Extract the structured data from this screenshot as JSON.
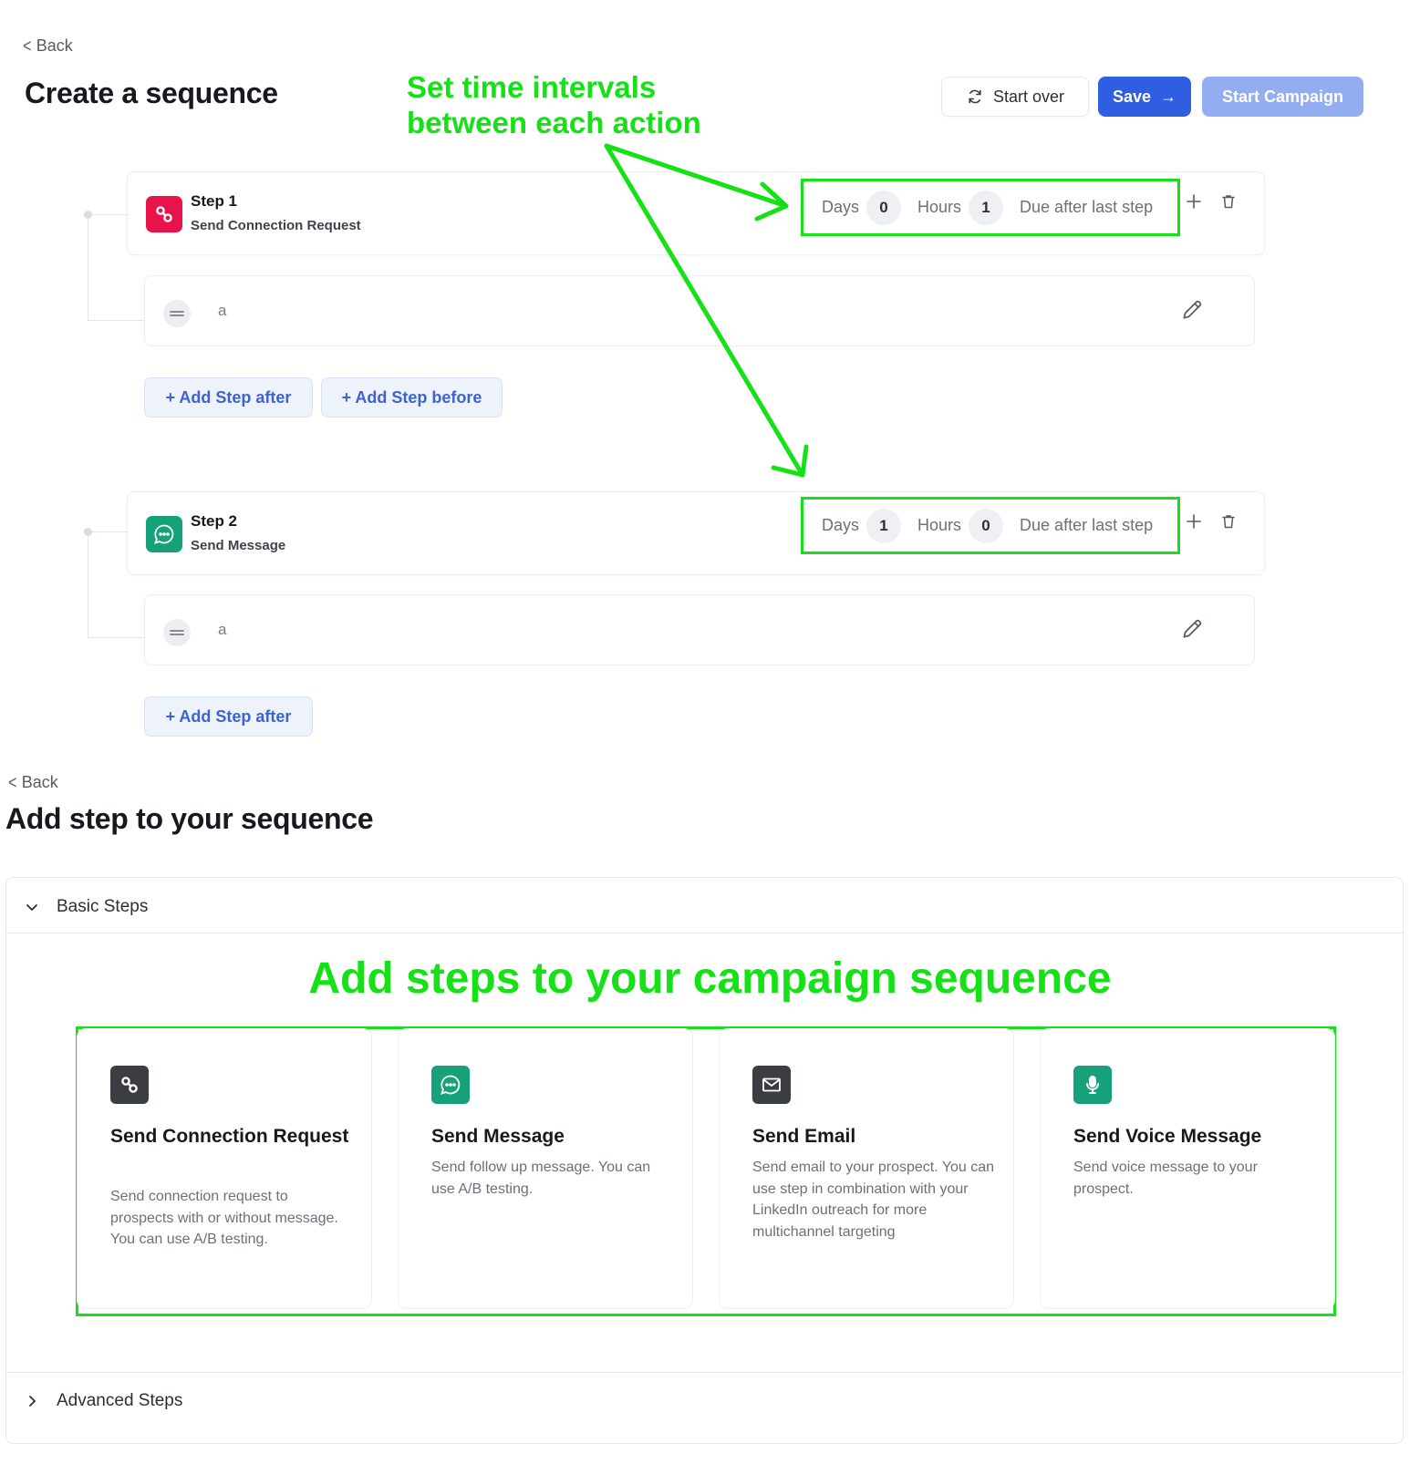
{
  "header": {
    "back_label": "Back",
    "title": "Create a sequence",
    "start_over_label": "Start over",
    "save_label": "Save",
    "start_campaign_label": "Start Campaign"
  },
  "annotations": {
    "intervals_line1": "Set time intervals",
    "intervals_line2": "between each action",
    "add_steps": "Add steps to your campaign sequence"
  },
  "steps": [
    {
      "title": "Step 1",
      "subtitle": "Send Connection Request",
      "icon": "link-icon",
      "icon_color": "#e8134a",
      "days_label": "Days",
      "days": "0",
      "hours_label": "Hours",
      "hours": "1",
      "due_label": "Due after last step",
      "message": "a",
      "add_after_label": "+ Add Step after",
      "add_before_label": "+ Add Step before"
    },
    {
      "title": "Step 2",
      "subtitle": "Send Message",
      "icon": "chat-icon",
      "icon_color": "#17a17a",
      "days_label": "Days",
      "days": "1",
      "hours_label": "Hours",
      "hours": "0",
      "due_label": "Due after last step",
      "message": "a",
      "add_after_label": "+ Add Step after"
    }
  ],
  "add_step": {
    "back_label": "Back",
    "title": "Add step to your sequence",
    "basic_label": "Basic Steps",
    "advanced_label": "Advanced Steps",
    "cards": [
      {
        "title": "Send Connection Request",
        "description": "Send connection request to prospects with or without message. You can use A/B testing.",
        "icon": "link-icon",
        "icon_color": "#3a3d42"
      },
      {
        "title": "Send Message",
        "description": "Send follow up message. You can use A/B testing.",
        "icon": "chat-icon",
        "icon_color": "#17a17a"
      },
      {
        "title": "Send Email",
        "description": "Send email to your prospect. You can use step in combination with your LinkedIn outreach for more multichannel targeting",
        "icon": "mail-icon",
        "icon_color": "#3a3d42"
      },
      {
        "title": "Send Voice Message",
        "description": "Send voice message to your prospect.",
        "icon": "mic-icon",
        "icon_color": "#17a17a"
      }
    ]
  },
  "colors": {
    "annotation": "#16e016",
    "primary": "#2f5fe0",
    "primary_disabled": "#93aef0"
  }
}
